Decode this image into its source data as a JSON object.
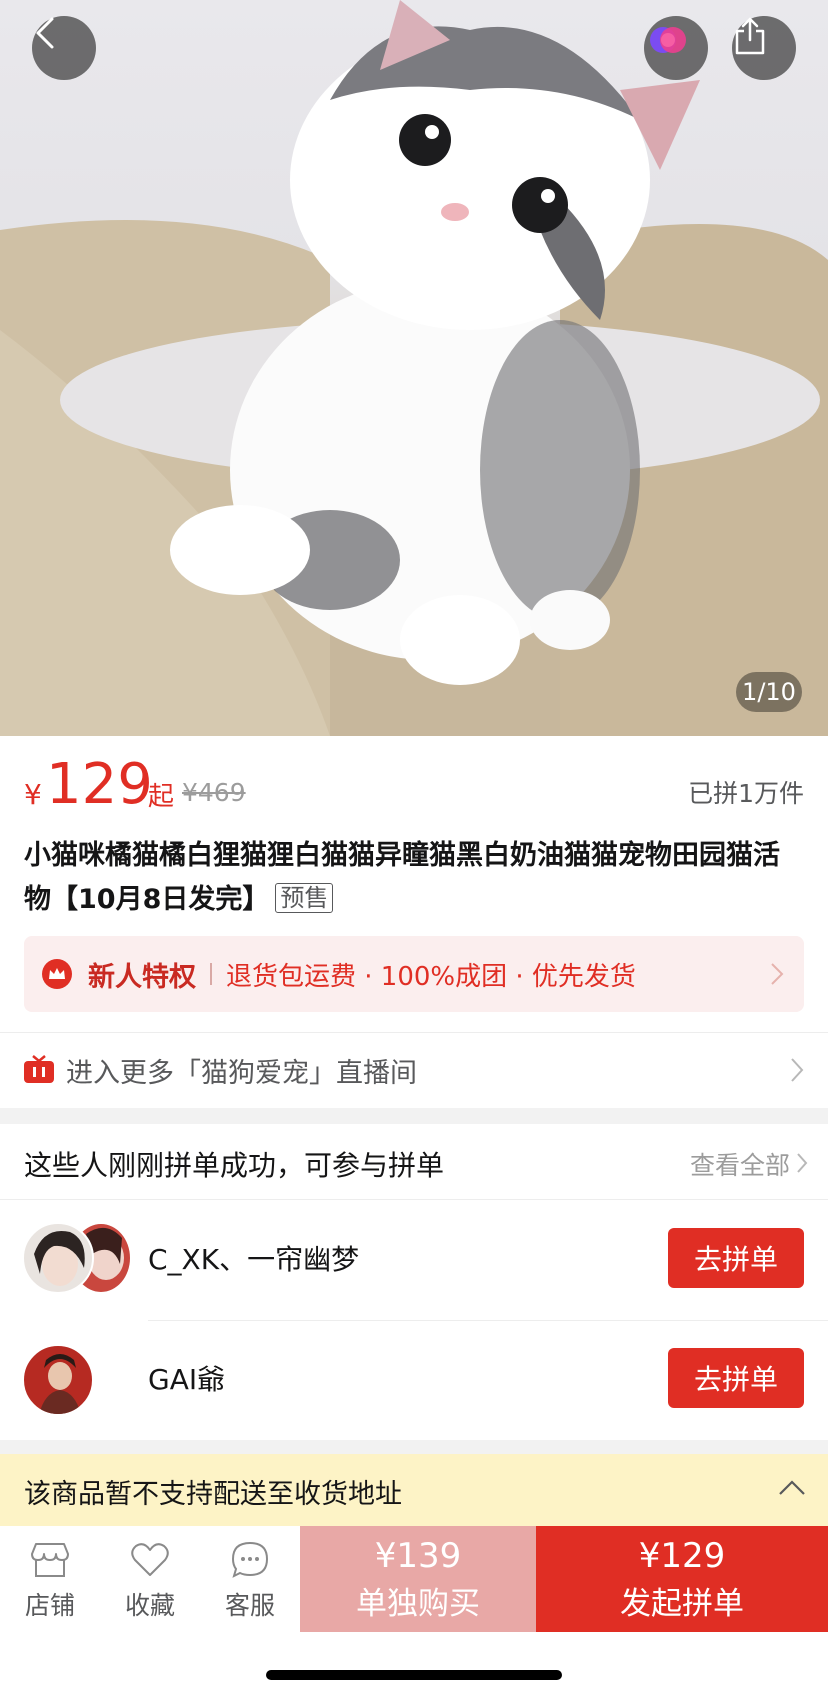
{
  "hero": {
    "counter": "1/10"
  },
  "price": {
    "currency": "¥",
    "amount": "129",
    "suffix": "起",
    "original": "¥469",
    "sold": "已拼1万件"
  },
  "title": {
    "text": "小猫咪橘猫橘白狸猫狸白猫猫异瞳猫黑白奶油猫猫宠物田园猫活物【10月8日发完】",
    "tag": "预售"
  },
  "privilege": {
    "label": "新人特权",
    "benefits": "退货包运费 · 100%成团 · 优先发货"
  },
  "live": {
    "text": "进入更多「猫狗爱宠」直播间"
  },
  "groups": {
    "heading": "这些人刚刚拼单成功，可参与拼单",
    "view_all": "查看全部",
    "rows": [
      {
        "names": "C_XK、一帘幽梦",
        "button": "去拼单"
      },
      {
        "names": "GAI爺",
        "button": "去拼单"
      }
    ]
  },
  "notice": {
    "text": "该商品暂不支持配送至收货地址"
  },
  "bottom_bar": {
    "shop": "店铺",
    "favorite": "收藏",
    "service": "客服",
    "solo_price": "¥139",
    "solo_label": "单独购买",
    "group_price": "¥129",
    "group_label": "发起拼单"
  },
  "colors": {
    "accent": "#e02e24",
    "solo_bg": "#e8a8a6",
    "notice_bg": "#fdf3c6"
  }
}
